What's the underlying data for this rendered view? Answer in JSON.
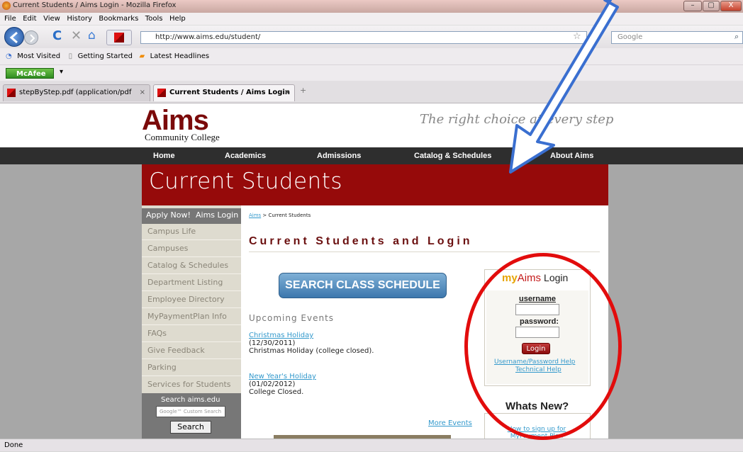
{
  "window": {
    "title": "Current Students / Aims Login - Mozilla Firefox",
    "buttons": [
      "–",
      "▢",
      "X"
    ]
  },
  "menu": [
    "File",
    "Edit",
    "View",
    "History",
    "Bookmarks",
    "Tools",
    "Help"
  ],
  "toolbar": {
    "url": "http://www.aims.edu/student/",
    "search_placeholder": "Google"
  },
  "bookmarks": [
    "Most Visited",
    "Getting Started",
    "Latest Headlines"
  ],
  "addon": {
    "label": "McAfee"
  },
  "tabs": [
    {
      "label": "stepByStep.pdf (application/pdf Ob...",
      "close": "×"
    },
    {
      "label": "Current Students / Aims Login",
      "close": "×"
    },
    {
      "label": "+"
    }
  ],
  "site": {
    "logo": "Aims",
    "logo_sub": "Community College",
    "tagline": "The right choice at every step",
    "nav": [
      "Home",
      "Academics",
      "Admissions",
      "Catalog & Schedules",
      "About Aims"
    ],
    "banner": "Current Students"
  },
  "sidebar": {
    "top_links": [
      "Apply Now!",
      "Aims Login"
    ],
    "items": [
      "Campus Life",
      "Campuses",
      "Catalog & Schedules",
      "Department Listing",
      "Employee Directory",
      "MyPaymentPlan Info",
      "FAQs",
      "Give Feedback",
      "Parking",
      "Services for Students"
    ],
    "search_label": "Search aims.edu",
    "search_placeholder": "Google™ Custom Search",
    "search_button": "Search"
  },
  "content": {
    "breadcrumb_link": "Aims",
    "breadcrumb_rest": " > Current Students",
    "title": "Current Students and Login",
    "search_schedule_button": "SEARCH CLASS SCHEDULE",
    "events_heading": "Upcoming Events",
    "events": [
      {
        "name": "Christmas Holiday",
        "date": "(12/30/2011)",
        "desc": "Christmas Holiday (college closed)."
      },
      {
        "name": "New Year's Holiday",
        "date": "(01/02/2012)",
        "desc": "College Closed."
      }
    ],
    "more_events": "More Events"
  },
  "login": {
    "brand_my": "my",
    "brand_aims": "Aims",
    "brand_login": "Login",
    "username_label": "username",
    "password_label": "password:",
    "button": "Login",
    "help_links": [
      "Username/Password Help",
      "Technical Help"
    ]
  },
  "whats_new": {
    "heading": "Whats New?",
    "link": "How to sign up for MyPayment Plan"
  },
  "status": "Done",
  "annotation_colors": {
    "arrow": "#3a6fd0",
    "ellipse": "#e20c0c"
  }
}
